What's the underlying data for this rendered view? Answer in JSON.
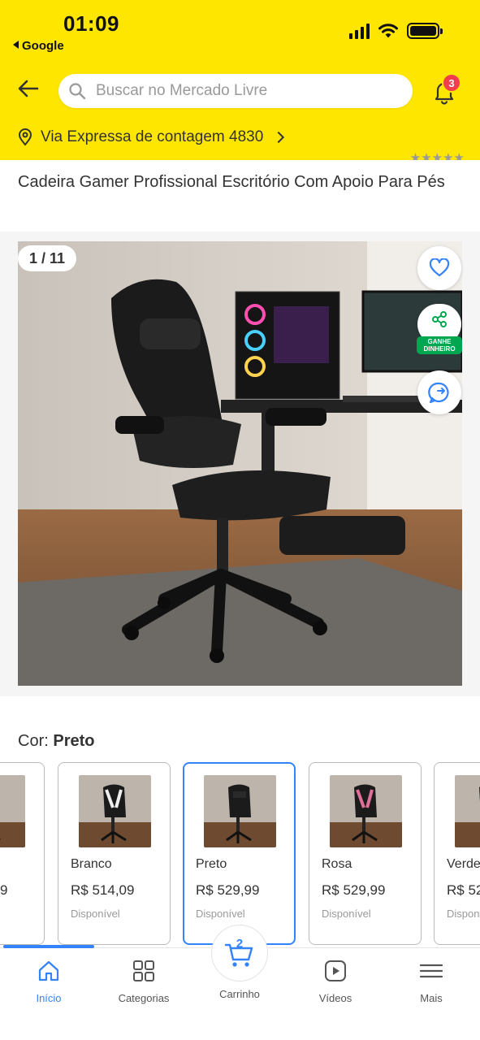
{
  "status_bar": {
    "time": "01:09",
    "back_app": "Google"
  },
  "header": {
    "search_placeholder": "Buscar no Mercado Livre",
    "notifications_count": "3",
    "address": "Via Expressa de contagem 4830"
  },
  "product": {
    "title": "Cadeira Gamer Profissional Escritório Com Apoio Para Pés",
    "gallery_counter": "1 / 11",
    "earn_label": "GANHE DINHEIRO"
  },
  "variants": {
    "label": "Cor:",
    "selected": "Preto",
    "cards": [
      {
        "name": "",
        "price": "9",
        "stock": ""
      },
      {
        "name": "Branco",
        "price": "R$ 514,09",
        "stock": "Disponível"
      },
      {
        "name": "Preto",
        "price": "R$ 529,99",
        "stock": "Disponível"
      },
      {
        "name": "Rosa",
        "price": "R$ 529,99",
        "stock": "Disponível"
      },
      {
        "name": "Verde",
        "price": "R$ 52",
        "stock": "Dispon"
      }
    ]
  },
  "bottom_nav": {
    "items": [
      {
        "label": "Início",
        "icon": "home-icon"
      },
      {
        "label": "Categorias",
        "icon": "grid-icon"
      },
      {
        "label": "Carrinho",
        "icon": "cart-icon"
      },
      {
        "label": "Vídeos",
        "icon": "play-icon"
      },
      {
        "label": "Mais",
        "icon": "menu-icon"
      }
    ],
    "cart_count": "2"
  },
  "colors": {
    "brand_yellow": "#FFE600",
    "accent_blue": "#3483FA",
    "badge_red": "#F23D4F",
    "earn_green": "#00A650"
  }
}
